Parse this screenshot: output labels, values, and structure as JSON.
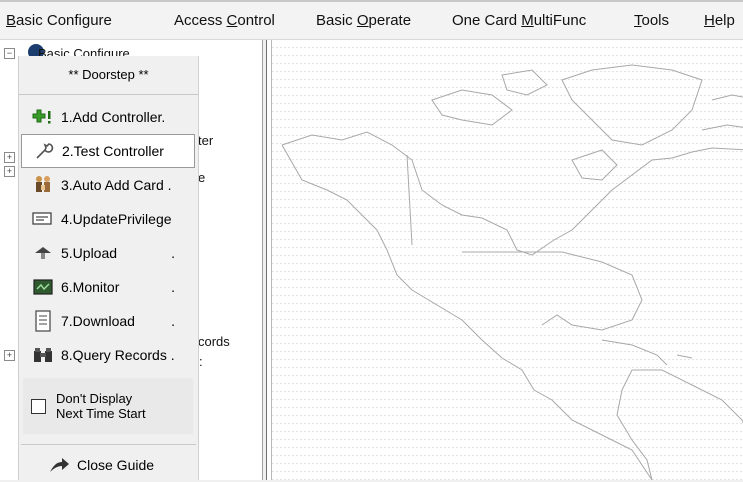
{
  "menu": [
    {
      "label": "Basic Configure",
      "accel": "B"
    },
    {
      "label": "Access Control",
      "accel": "C"
    },
    {
      "label": "Basic Operate",
      "accel": "O"
    },
    {
      "label": "One Card MultiFunc",
      "accel": "M"
    },
    {
      "label": "Tools",
      "accel": "T"
    },
    {
      "label": "Help",
      "accel": "H"
    }
  ],
  "tree": {
    "root_label": "Basic Configure",
    "partial_1": "ter",
    "partial_2": "e",
    "partial_3": "cords",
    "partial_4": ":"
  },
  "guide": {
    "title": "** Doorstep **",
    "items": [
      {
        "label": "1.Add Controller.",
        "icon": "add-controller-icon"
      },
      {
        "label": "2.Test Controller",
        "icon": "wrench-icon"
      },
      {
        "label": "3.Auto Add Card .",
        "icon": "people-icon"
      },
      {
        "label": "4.UpdatePrivilege",
        "icon": "card-reader-icon"
      },
      {
        "label": "5.Upload",
        "icon": "upload-icon",
        "suffix": "."
      },
      {
        "label": "6.Monitor",
        "icon": "monitor-icon",
        "suffix": "."
      },
      {
        "label": "7.Download",
        "icon": "download-icon",
        "suffix": "."
      },
      {
        "label": "8.Query Records .",
        "icon": "binoculars-icon"
      }
    ],
    "dont_display": "Don't Display Next Time Start",
    "dont_display_line1": "Don't Display",
    "dont_display_line2": "Next Time Start",
    "dont_display_checked": false,
    "close_label": "Close Guide"
  },
  "colors": {
    "accent_green": "#3a9a2a",
    "tree_root_icon": "#1a3d6e"
  }
}
